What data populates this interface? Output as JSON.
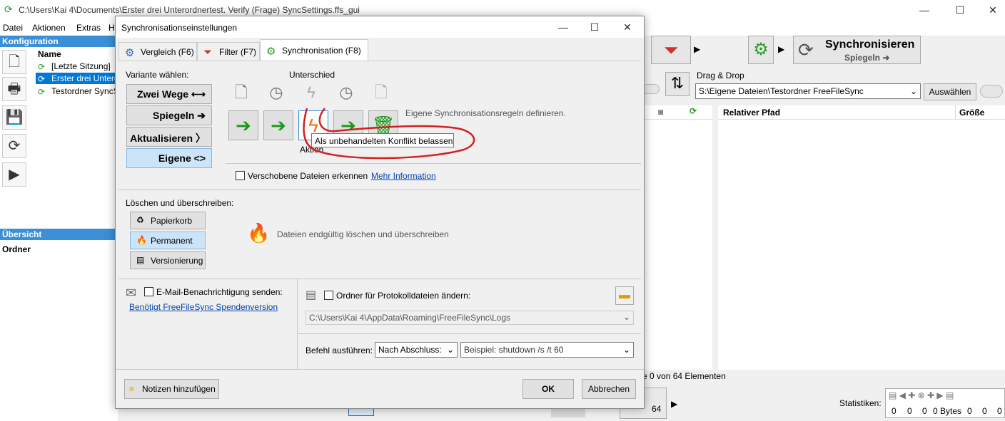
{
  "main_window": {
    "title": "C:\\Users\\Kai 4\\Documents\\Erster drei Unterordnertest. Verify (Frage) SyncSettings.ffs_gui",
    "menu": [
      "Datei",
      "Aktionen",
      "Extras",
      "H"
    ],
    "config_header": "Konfiguration",
    "name_col": "Name",
    "configs": [
      "[Letzte Sitzung]",
      "Erster drei Unterc",
      "Testordner SyncS"
    ],
    "overview_header": "Übersicht",
    "folder_col": "Ordner",
    "sync_button": {
      "label": "Synchronisieren",
      "sub": "Spiegeln ➜"
    },
    "dragdrop_label": "Drag & Drop",
    "right_path": "S:\\Eigene Dateien\\Testordner FreeFileSync",
    "browse_button": "Auswählen",
    "col_relpath": "Relativer Pfad",
    "col_size": "Größe",
    "status_elements": "e 0 von 64 Elementen",
    "count_64": "64",
    "stats_label": "Statistiken:",
    "stats_values": [
      "0",
      "0",
      "0",
      "0 Bytes",
      "0",
      "0",
      "0"
    ]
  },
  "dialog": {
    "title": "Synchronisationseinstellungen",
    "tabs": [
      {
        "label": "Vergleich (F6)",
        "icon": "gear-icon"
      },
      {
        "label": "Filter (F7)",
        "icon": "filter-icon"
      },
      {
        "label": "Synchronisation (F8)",
        "icon": "gear-green-icon"
      }
    ],
    "variant_label": "Variante wählen:",
    "variants": [
      {
        "label": "Zwei Wege",
        "arrow": "⟷"
      },
      {
        "label": "Spiegeln",
        "arrow": "➔"
      },
      {
        "label": "Aktualisieren",
        "arrow": "〉"
      },
      {
        "label": "Eigene",
        "arrow": "<>"
      }
    ],
    "difference_label": "Unterschied",
    "action_label": "Aktion",
    "custom_rules_text": "Eigene Synchronisationsregeln definieren.",
    "tooltip": "Als unbehandelten Konflikt belassen",
    "detect_moved": "Verschobene Dateien erkennen",
    "more_info": "Mehr Information",
    "delete_label": "Löschen und überschreiben:",
    "delete_options": [
      "Papierkorb",
      "Permanent",
      "Versionierung"
    ],
    "permanent_desc": "Dateien endgültig löschen und überschreiben",
    "email_label": "E-Mail-Benachrichtigung senden:",
    "donation_link": "Benötigt FreeFileSync Spendenversion",
    "log_folder_label": "Ordner für Protokolldateien ändern:",
    "log_path": "C:\\Users\\Kai 4\\AppData\\Roaming\\FreeFileSync\\Logs",
    "command_label": "Befehl ausführen:",
    "command_when": "Nach Abschluss:",
    "command_placeholder": "Beispiel: shutdown /s /t 60",
    "notes_button": "Notizen hinzufügen",
    "ok_button": "OK",
    "cancel_button": "Abbrechen"
  }
}
